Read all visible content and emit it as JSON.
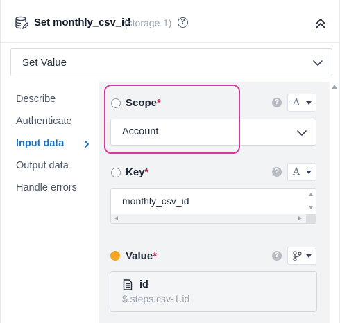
{
  "header": {
    "icon": "database-icon",
    "title": "Set monthly_csv_id",
    "subtitle": "(storage-1)",
    "help_glyph": "?"
  },
  "action": {
    "selected": "Set Value"
  },
  "sidebar": {
    "items": [
      {
        "label": "Describe"
      },
      {
        "label": "Authenticate"
      },
      {
        "label": "Input data"
      },
      {
        "label": "Output data"
      },
      {
        "label": "Handle errors"
      }
    ],
    "active": "Input data"
  },
  "fields": {
    "scope": {
      "label": "Scope",
      "required_mark": "*",
      "help_glyph": "?",
      "type_glyph": "A",
      "value": "Account"
    },
    "key": {
      "label": "Key",
      "required_mark": "*",
      "help_glyph": "?",
      "type_glyph": "A",
      "value": "monthly_csv_id"
    },
    "value": {
      "label": "Value",
      "required_mark": "*",
      "help_glyph": "?",
      "type_icon": "branch-icon",
      "ref_title": "id",
      "ref_path": "$.steps.csv-1.id"
    }
  },
  "colors": {
    "accent": "#1f74c6",
    "required": "#d81b60",
    "highlight": "#d63a9e",
    "value_dot": "#f5a623"
  }
}
